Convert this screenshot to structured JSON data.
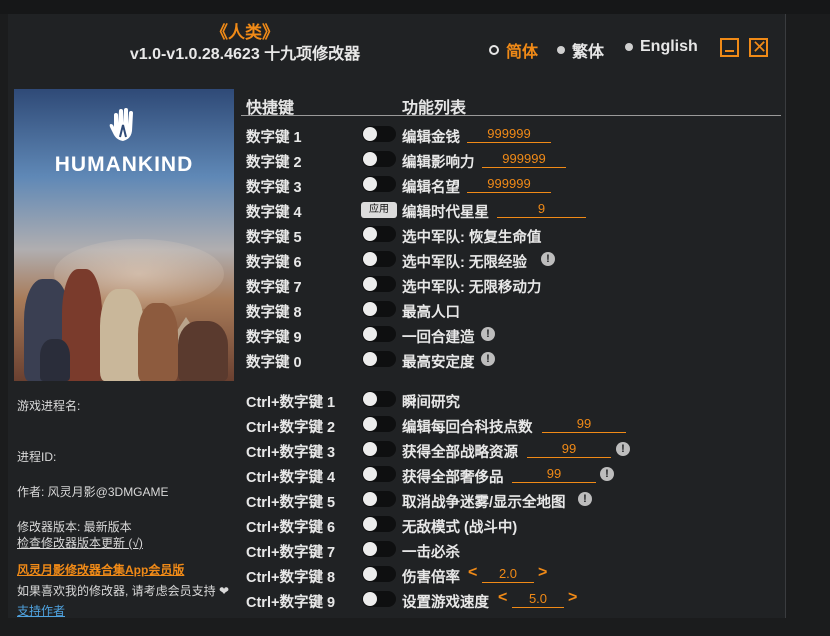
{
  "header": {
    "title": "《人类》",
    "subtitle": "v1.0-v1.0.28.4623 十九项修改器",
    "languages": [
      {
        "label": "简体",
        "selected": true
      },
      {
        "label": "繁体",
        "selected": false
      },
      {
        "label": "English",
        "selected": false
      }
    ],
    "accent_color": "#f08a17"
  },
  "cover": {
    "logo_text": "HUMANKIND"
  },
  "sidebar": {
    "process_name_label": "游戏进程名:",
    "process_id_label": "进程ID:",
    "author": "作者: 风灵月影@3DMGAME",
    "version": "修改器版本: 最新版本",
    "check_update": "检查修改器版本更新 (√)",
    "promo": "风灵月影修改器合集App会员版",
    "support_text": "如果喜欢我的修改器, 请考虑会员支持",
    "support_link": "支持作者"
  },
  "table": {
    "col_hotkey": "快捷键",
    "col_function": "功能列表",
    "rows": [
      {
        "key": "数字键 1",
        "label": "编辑金钱",
        "value": "999999"
      },
      {
        "key": "数字键 2",
        "label": "编辑影响力",
        "value": "999999"
      },
      {
        "key": "数字键 3",
        "label": "编辑名望",
        "value": "999999"
      },
      {
        "key": "数字键 4",
        "label": "编辑时代星星",
        "value": "9",
        "button": "应用"
      },
      {
        "key": "数字键 5",
        "label": "选中军队: 恢复生命值"
      },
      {
        "key": "数字键 6",
        "label": "选中军队: 无限经验"
      },
      {
        "key": "数字键 7",
        "label": "选中军队: 无限移动力"
      },
      {
        "key": "数字键 8",
        "label": "最高人口"
      },
      {
        "key": "数字键 9",
        "label": "一回合建造"
      },
      {
        "key": "数字键 0",
        "label": "最高安定度"
      },
      {
        "key": "Ctrl+数字键 1",
        "label": "瞬间研究"
      },
      {
        "key": "Ctrl+数字键 2",
        "label": "编辑每回合科技点数",
        "value": "99"
      },
      {
        "key": "Ctrl+数字键 3",
        "label": "获得全部战略资源",
        "value": "99"
      },
      {
        "key": "Ctrl+数字键 4",
        "label": "获得全部奢侈品",
        "value": "99"
      },
      {
        "key": "Ctrl+数字键 5",
        "label": "取消战争迷雾/显示全地图"
      },
      {
        "key": "Ctrl+数字键 6",
        "label": "无敌模式 (战斗中)"
      },
      {
        "key": "Ctrl+数字键 7",
        "label": "一击必杀"
      },
      {
        "key": "Ctrl+数字键 8",
        "label": "伤害倍率",
        "value": "2.0"
      },
      {
        "key": "Ctrl+数字键 9",
        "label": "设置游戏速度",
        "value": "5.0"
      }
    ]
  }
}
